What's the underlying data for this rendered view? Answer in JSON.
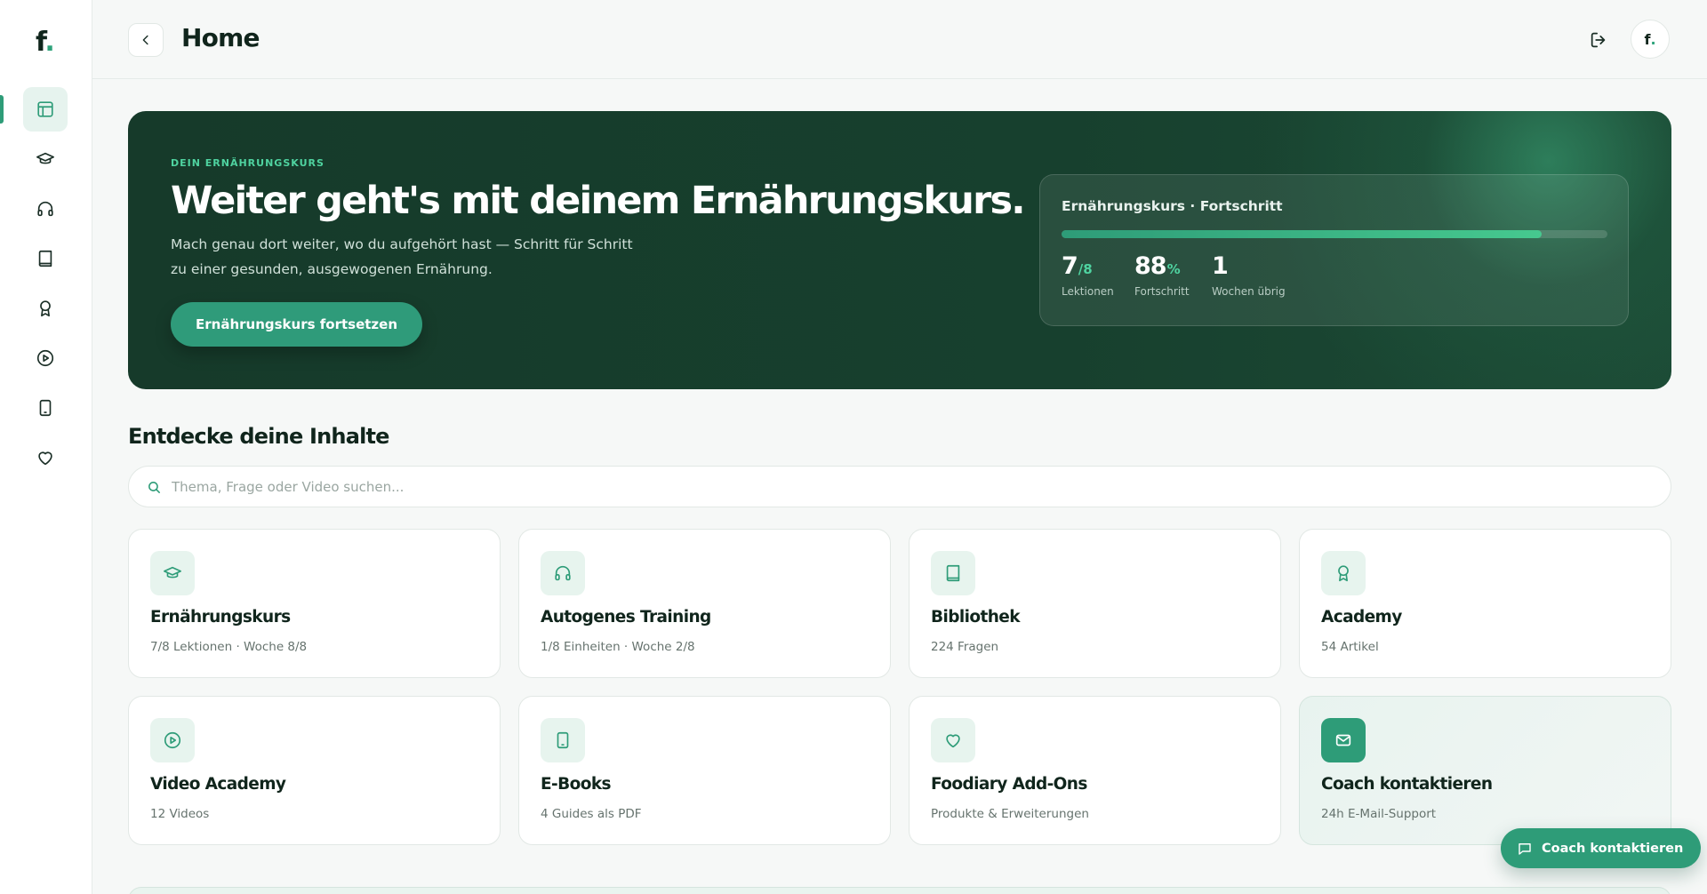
{
  "brand": {
    "logo_letter": "f",
    "logo_dot": ".",
    "accent": "#2e9c78"
  },
  "sidebar": {
    "items": [
      {
        "name": "dashboard",
        "icon": "layout-icon",
        "active": true
      },
      {
        "name": "course",
        "icon": "graduation-cap-icon",
        "active": false
      },
      {
        "name": "audio",
        "icon": "headphones-icon",
        "active": false
      },
      {
        "name": "library",
        "icon": "book-icon",
        "active": false
      },
      {
        "name": "academy",
        "icon": "award-icon",
        "active": false
      },
      {
        "name": "video",
        "icon": "play-circle-icon",
        "active": false
      },
      {
        "name": "ebooks",
        "icon": "tablet-icon",
        "active": false
      },
      {
        "name": "addons",
        "icon": "heart-icon",
        "active": false
      }
    ]
  },
  "header": {
    "title": "Home",
    "avatar_letter": "f",
    "avatar_dot": "."
  },
  "hero": {
    "eyebrow": "DEIN ERNÄHRUNGSKURS",
    "title": "Weiter geht's mit deinem Ernährungskurs.",
    "subtitle": "Mach genau dort weiter, wo du aufgehört hast — Schritt für Schritt zu einer gesunden, ausgewogenen Ernährung.",
    "cta_label": "Ernährungskurs fortsetzen",
    "progress": {
      "title": "Ernährungskurs · Fortschritt",
      "fill_percent": 88,
      "stats": [
        {
          "value": "7",
          "suffix": "/8",
          "label": "Lektionen"
        },
        {
          "value": "88",
          "suffix": "%",
          "label": "Fortschritt"
        },
        {
          "value": "1",
          "suffix": "",
          "label": "Wochen übrig"
        }
      ]
    }
  },
  "section": {
    "title": "Entdecke deine Inhalte",
    "search_placeholder": "Thema, Frage oder Video suchen..."
  },
  "cards": [
    {
      "title": "Ernährungskurs",
      "subtitle": "7/8 Lektionen · Woche 8/8",
      "icon": "graduation-cap-icon"
    },
    {
      "title": "Autogenes Training",
      "subtitle": "1/8 Einheiten · Woche 2/8",
      "icon": "headphones-icon"
    },
    {
      "title": "Bibliothek",
      "subtitle": "224 Fragen",
      "icon": "book-icon"
    },
    {
      "title": "Academy",
      "subtitle": "54 Artikel",
      "icon": "award-icon"
    },
    {
      "title": "Video Academy",
      "subtitle": "12 Videos",
      "icon": "play-circle-icon"
    },
    {
      "title": "E-Books",
      "subtitle": "4 Guides als PDF",
      "icon": "tablet-icon"
    },
    {
      "title": "Foodiary Add-Ons",
      "subtitle": "Produkte & Erweiterungen",
      "icon": "heart-icon"
    },
    {
      "title": "Coach kontaktieren",
      "subtitle": "24h E-Mail-Support",
      "icon": "mail-icon"
    }
  ],
  "fab": {
    "label": "Coach kontaktieren",
    "icon": "message-icon"
  }
}
